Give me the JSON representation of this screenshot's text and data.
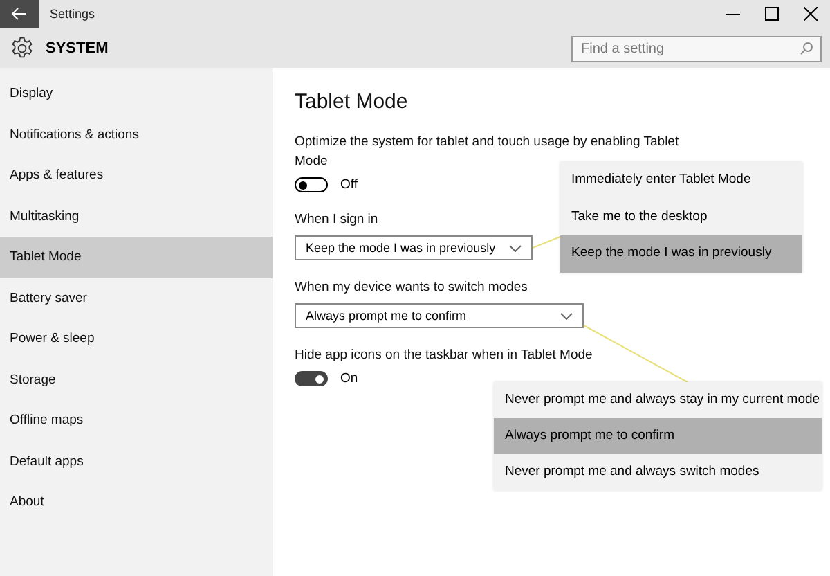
{
  "window": {
    "title": "Settings"
  },
  "header": {
    "title": "SYSTEM",
    "search": {
      "placeholder": "Find a setting"
    }
  },
  "sidebar": {
    "items": [
      {
        "label": "Display",
        "selected": false
      },
      {
        "label": "Notifications & actions",
        "selected": false
      },
      {
        "label": "Apps & features",
        "selected": false
      },
      {
        "label": "Multitasking",
        "selected": false
      },
      {
        "label": "Tablet Mode",
        "selected": true
      },
      {
        "label": "Battery saver",
        "selected": false
      },
      {
        "label": "Power & sleep",
        "selected": false
      },
      {
        "label": "Storage",
        "selected": false
      },
      {
        "label": "Offline maps",
        "selected": false
      },
      {
        "label": "Default apps",
        "selected": false
      },
      {
        "label": "About",
        "selected": false
      }
    ]
  },
  "content": {
    "title": "Tablet Mode",
    "settings": [
      {
        "kind": "toggle",
        "label": "Optimize the system for tablet and touch usage by enabling Tablet Mode",
        "on": false,
        "state_label": "Off"
      },
      {
        "kind": "dropdown",
        "label": "When I sign in",
        "value": "Keep the mode I was in previously",
        "options": [
          {
            "label": "Immediately enter Tablet Mode",
            "selected": false
          },
          {
            "label": "Take me to the desktop",
            "selected": false
          },
          {
            "label": "Keep the mode I was in previously",
            "selected": true
          }
        ]
      },
      {
        "kind": "dropdown",
        "label": "When my device wants to switch modes",
        "value": "Always prompt me to confirm",
        "options": [
          {
            "label": "Never prompt me and always stay in my current mode",
            "selected": false
          },
          {
            "label": "Always prompt me to confirm",
            "selected": true
          },
          {
            "label": "Never prompt me and always switch modes",
            "selected": false
          }
        ]
      },
      {
        "kind": "toggle",
        "label": "Hide app icons on the taskbar when in Tablet Mode",
        "on": true,
        "state_label": "On"
      }
    ]
  }
}
